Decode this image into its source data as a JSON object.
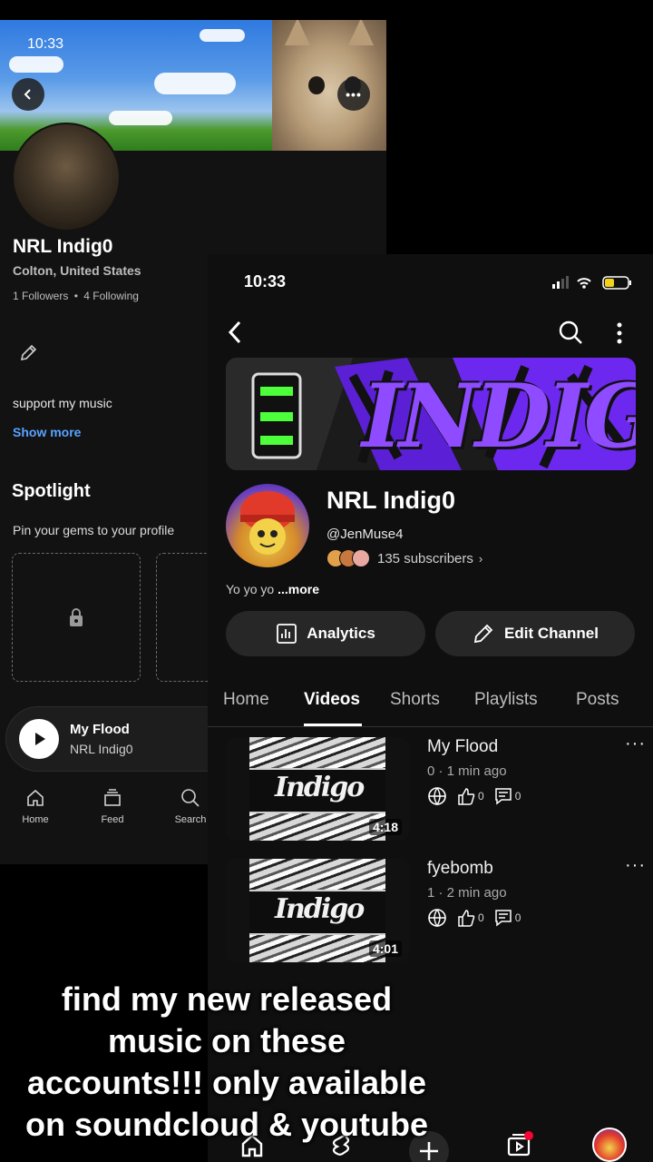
{
  "soundcloud": {
    "status_time": "10:33",
    "profile": {
      "name": "NRL Indig0",
      "location": "Colton, United States",
      "followers": "1 Followers",
      "following": "4 Following",
      "bio": "support my music",
      "show_more": "Show more"
    },
    "spotlight": {
      "title": "Spotlight",
      "subtitle": "Pin your gems to your profile"
    },
    "mini_player": {
      "track": "My Flood",
      "artist": "NRL Indig0"
    },
    "nav": [
      {
        "label": "Home",
        "icon": "home-icon"
      },
      {
        "label": "Feed",
        "icon": "feed-icon"
      },
      {
        "label": "Search",
        "icon": "search-icon"
      }
    ]
  },
  "youtube": {
    "status_time": "10:33",
    "banner_text": "INDIGO",
    "channel": {
      "name": "NRL Indig0",
      "handle": "@JenMuse4",
      "subscribers": "135 subscribers",
      "description_text": "Yo yo yo",
      "description_more": "...more"
    },
    "buttons": {
      "analytics": "Analytics",
      "edit_channel": "Edit Channel"
    },
    "tabs": [
      "Home",
      "Videos",
      "Shorts",
      "Playlists",
      "Posts"
    ],
    "active_tab": "Videos",
    "videos": [
      {
        "title": "My Flood",
        "meta": "0 · 1 min ago",
        "likes": "0",
        "comments": "0",
        "duration": "4:18"
      },
      {
        "title": "fyebomb",
        "meta": "1 · 2 min ago",
        "likes": "0",
        "comments": "0",
        "duration": "4:01"
      }
    ],
    "bottom_nav": [
      {
        "icon": "home-icon"
      },
      {
        "icon": "shorts-icon"
      },
      {
        "icon": "create-icon"
      },
      {
        "icon": "subscriptions-icon"
      },
      {
        "icon": "avatar"
      }
    ],
    "accent_color": "#7b2ff2"
  },
  "caption": "find my new released\nmusic on these\naccounts!!! only available\non soundcloud & youtube"
}
